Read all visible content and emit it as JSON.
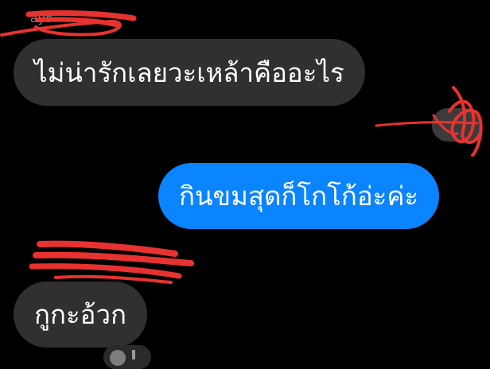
{
  "conversation": {
    "sender_name_partial": "ayo",
    "messages": [
      {
        "direction": "incoming",
        "text": "ไม่น่ารักเลยวะเหล้าคืออะไร"
      },
      {
        "direction": "outgoing",
        "text": "กินขมสุดก็โกโก้อ่ะค่ะ"
      },
      {
        "direction": "incoming",
        "text": "กูกะอ้วก"
      }
    ]
  },
  "colors": {
    "background": "#000000",
    "incoming_bubble": "#303030",
    "outgoing_bubble": "#0a84ff",
    "text": "#ffffff",
    "redaction": "#e8322f"
  },
  "icons": {
    "avatar": "avatar-icon",
    "reaction": "reaction-icon"
  }
}
